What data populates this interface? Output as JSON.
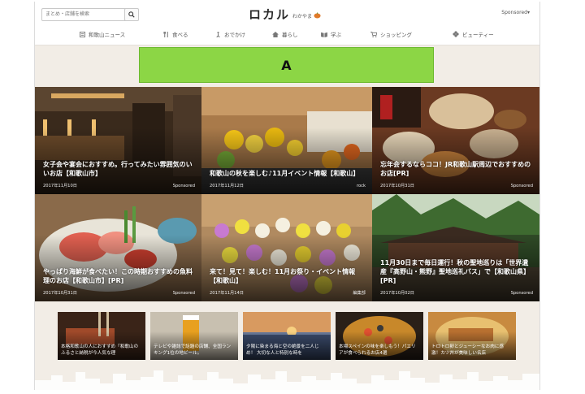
{
  "header": {
    "search_placeholder": "まとめ・店舗を検索",
    "logo_main": "ロカル",
    "logo_sub": "わかやま",
    "sponsored": "Sponsored▾"
  },
  "nav": [
    {
      "label": "和歌山ニュース",
      "icon": "newspaper-icon"
    },
    {
      "label": "食べる",
      "icon": "fork-knife-icon"
    },
    {
      "label": "おでかけ",
      "icon": "person-walking-icon"
    },
    {
      "label": "暮らし",
      "icon": "house-icon"
    },
    {
      "label": "学ぶ",
      "icon": "book-icon"
    },
    {
      "label": "ショッピング",
      "icon": "shopping-cart-icon"
    },
    {
      "label": "ビューティー",
      "icon": "flower-icon"
    }
  ],
  "ad_banner": {
    "text": "A",
    "color": "#8cd645"
  },
  "articles": [
    {
      "title": "女子会や宴会におすすめ。行ってみたい雰囲気のいいお店【和歌山市】",
      "date": "2017年11月10日",
      "author": "Sponsored"
    },
    {
      "title": "和歌山の秋を楽しむ♪11月イベント情報【和歌山】",
      "date": "2017年11月12日",
      "author": "rock"
    },
    {
      "title": "忘年会するならココ！JR和歌山駅周辺でおすすめのお店[PR]",
      "date": "2017年10月31日",
      "author": "Sponsored"
    },
    {
      "title": "やっぱり海鮮が食べたい！この時期おすすめの魚料理のお店【和歌山市】[PR]",
      "date": "2017年10月31日",
      "author": "Sponsored"
    },
    {
      "title": "来て！見て！楽しむ！11月お祭り・イベント情報【和歌山】",
      "date": "2017年11月14日",
      "author": "編集部"
    },
    {
      "title": "11月30日まで毎日運行！秋の聖地巡りは「世界遺産『高野山・熊野』聖地巡礼バス」で【和歌山県】[PR]",
      "date": "2017年10月02日",
      "author": "Sponsored"
    }
  ],
  "mini_articles": [
    {
      "title": "本格和歌山の人におすすめ「和歌山のふるさと納税が今人気な理"
    },
    {
      "title": "テレビや雑誌で話題の店舗、全国ランキング1位の地ビール。"
    },
    {
      "title": "夕陽に染まる海と空の絶景を二人じめ！ 大切な人と特別な時を"
    },
    {
      "title": "本場スペインの味を楽しもう！パエリアが食べられるお店4選"
    },
    {
      "title": "トロトロ卵とジューシーなお肉に感激！カツ丼が美味しい名店"
    }
  ],
  "colors": {
    "page_bg": "#f2ede6",
    "header_bg": "#ffffff",
    "accent": "#8cd645"
  }
}
